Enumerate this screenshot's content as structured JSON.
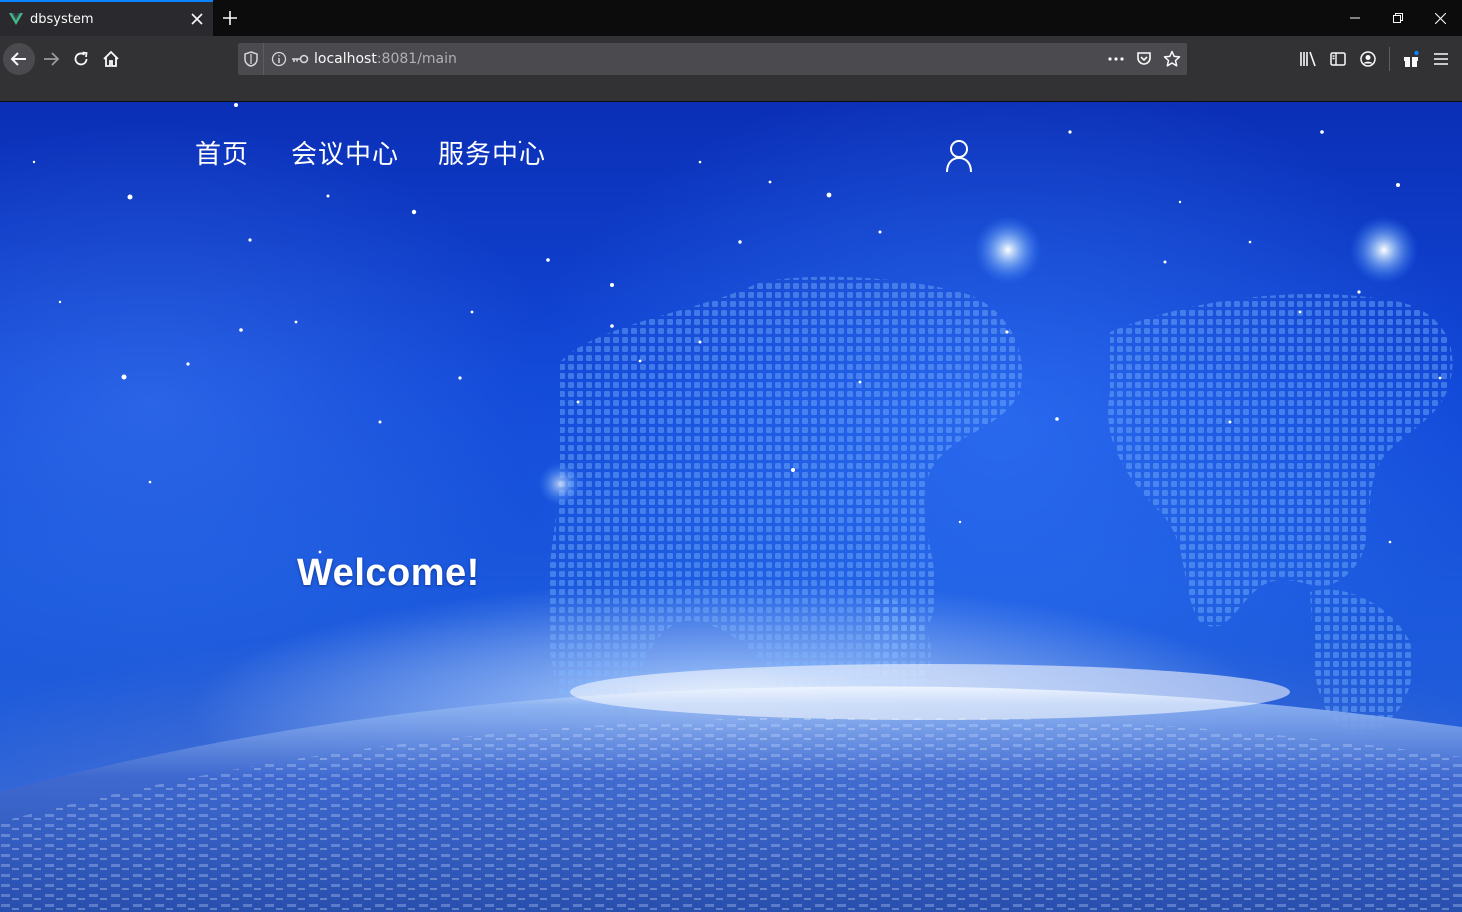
{
  "browser": {
    "tab": {
      "title": "dbsystem",
      "favicon": "vue-logo-icon"
    },
    "url": {
      "host": "localhost",
      "rest": ":8081/main"
    },
    "colors": {
      "accent": "#0a84ff",
      "tab_bg": "#2a2a2e",
      "toolbar_bg": "#323234",
      "urlbar_bg": "#4a4a4f"
    }
  },
  "site": {
    "nav": {
      "home": "首页",
      "meeting_center": "会议中心",
      "service_center": "服务中心"
    },
    "user_icon": "user-profile-icon",
    "welcome": "Welcome!",
    "colors": {
      "bg_top": "#0b2fb6",
      "bg_mid": "#1a58dd",
      "glow": "#ebf5ff",
      "text": "#ffffff"
    }
  }
}
